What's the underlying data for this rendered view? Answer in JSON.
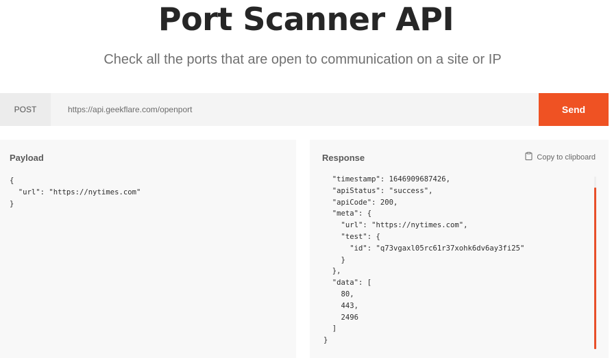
{
  "header": {
    "title": "Port Scanner API",
    "subtitle": "Check all the ports that are open to communication on a site or IP"
  },
  "request": {
    "method": "POST",
    "url": "https://api.geekflare.com/openport",
    "send_label": "Send"
  },
  "payload": {
    "title": "Payload",
    "code": "{\n  \"url\": \"https://nytimes.com\"\n}"
  },
  "response": {
    "title": "Response",
    "copy_label": "Copy to clipboard",
    "code": "  \"timestamp\": 1646909687426,\n  \"apiStatus\": \"success\",\n  \"apiCode\": 200,\n  \"meta\": {\n    \"url\": \"https://nytimes.com\",\n    \"test\": {\n      \"id\": \"q73vgaxl05rc61r37xohk6dv6ay3fi25\"\n    }\n  },\n  \"data\": [\n    80,\n    443,\n    2496\n  ]\n}"
  },
  "colors": {
    "accent": "#ef5223",
    "panel_bg": "#f8f8f8",
    "bar_bg": "#f4f4f4"
  },
  "icons": {
    "copy": "clipboard-icon"
  }
}
